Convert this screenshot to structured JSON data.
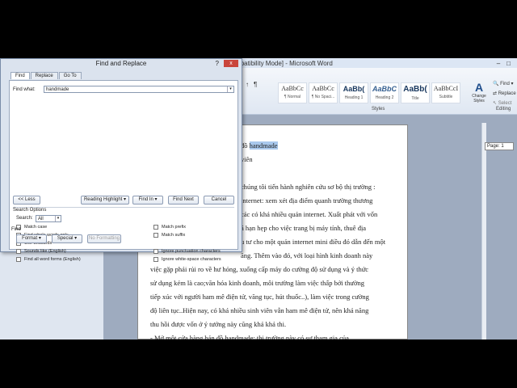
{
  "word": {
    "title": "mpatibility Mode] - Microsoft Word",
    "paragraph_buttons": [
      "↑",
      "¶"
    ],
    "styles": [
      {
        "sample": "AaBbCc",
        "label": "¶ Normal",
        "kind": "normal"
      },
      {
        "sample": "AaBbCc",
        "label": "¶ No Spaci...",
        "kind": "normal"
      },
      {
        "sample": "AaBb(",
        "label": "Heading 1",
        "kind": "h"
      },
      {
        "sample": "AaBbC",
        "label": "Heading 2",
        "kind": "hi"
      },
      {
        "sample": "AaBb(",
        "label": "Title",
        "kind": "ti"
      },
      {
        "sample": "AaBbCcI",
        "label": "Subtitle",
        "kind": "normal"
      }
    ],
    "styles_group": "Styles",
    "change_styles": "Change Styles",
    "editing": {
      "find": "Find",
      "replace": "Replace",
      "select": "Select",
      "label": "Editing"
    },
    "page_indicator": "Page: 1",
    "doc_lines": [
      {
        "pre": "đồ ",
        "hl": "handmade",
        "post": ""
      },
      {
        "pre": "viên",
        "hl": "",
        "post": ""
      },
      {
        "pre": "",
        "hl": "",
        "post": ""
      },
      {
        "pre": "chúng tôi tiến hành nghiên cứu sơ bộ thị trường :",
        "hl": "",
        "post": ""
      },
      {
        "pre": "internet: xem xét địa điểm quanh trường thương",
        "hl": "",
        "post": ""
      },
      {
        "pre": "các có khá nhiều quán internet. Xuất phát với vốn",
        "hl": "",
        "post": ""
      },
      {
        "pre": "á hạn hẹp cho việc  trang bị  máy tính, thuê địa",
        "hl": "",
        "post": ""
      },
      {
        "pre": "u tư cho một quán internet mini điều đó dẫn đến một",
        "hl": "",
        "post": ""
      },
      {
        "pre": "ăng. Thêm vào đó, với loại hình kinh doanh này",
        "hl": "",
        "post": ""
      },
      {
        "pre": "việc gặp phải rủi ro về hư hỏng, xuống cấp máy do cường độ sử dụng và ý thức",
        "hl": "",
        "post": ""
      },
      {
        "pre": "sử dụng kém là cao;văn hóa kinh doanh, môi trường làm việc thấp bởi thường",
        "hl": "",
        "post": ""
      },
      {
        "pre": "tiếp xúc với người ham mê điện tử, vãng tục, hút thuốc..), làm việc trong cường",
        "hl": "",
        "post": ""
      },
      {
        "pre": "độ liên tục..Hiện nay, có khá nhiều sinh viên vẫn ham mê điện tử, nên khả năng",
        "hl": "",
        "post": ""
      },
      {
        "pre": "thu hồi được vốn ở ý tưởng này cũng khá khả thi.",
        "hl": "",
        "post": ""
      },
      {
        "pre": "-       Mở một cửa hàng bán đồ handmade: thị trường này có sự tham gia của",
        "hl": "",
        "post": ""
      }
    ]
  },
  "dialog": {
    "title": "Find and Replace",
    "help": "?",
    "close": "x",
    "tabs": [
      "Find",
      "Replace",
      "Go To"
    ],
    "find_what_label": "Find what:",
    "find_what_value": "handmade",
    "buttons": {
      "less": "<< Less",
      "reading_highlight": "Reading Highlight ▾",
      "find_in": "Find In ▾",
      "find_next": "Find Next",
      "cancel": "Cancel",
      "format": "Format ▾",
      "special": "Special ▾",
      "no_formatting": "No Formatting"
    },
    "search_options_label": "Search Options",
    "search_label": "Search:",
    "search_value": "All",
    "left_options": [
      "Match case",
      "Find whole words only",
      "Use wildcards",
      "Sounds like (English)",
      "Find all word forms (English)"
    ],
    "right_options_top": [
      "Match prefix",
      "Match suffix"
    ],
    "right_options_bottom": [
      "Ignore punctuation characters",
      "Ignore white-space characters"
    ],
    "find_section_label": "Find"
  }
}
